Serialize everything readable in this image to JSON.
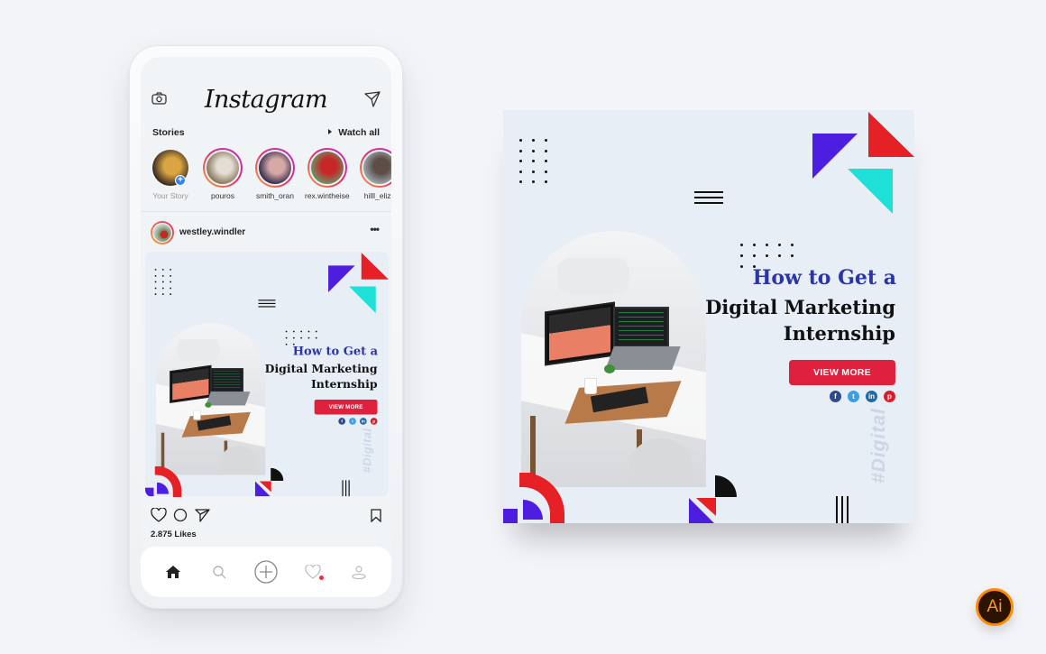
{
  "app": {
    "name": "Instagram"
  },
  "stories": {
    "label": "Stories",
    "watch_all": "Watch all",
    "items": [
      {
        "name": "Your Story",
        "own": true,
        "colors": [
          "#3a2a22",
          "#d9a441"
        ]
      },
      {
        "name": "pouros",
        "own": false,
        "colors": [
          "#8a7a5c",
          "#e4ddd3"
        ]
      },
      {
        "name": "smith_oran",
        "own": false,
        "colors": [
          "#3b3050",
          "#d6a9a6"
        ]
      },
      {
        "name": "rex.wintheiser",
        "own": false,
        "colors": [
          "#6f8f65",
          "#c62828"
        ]
      },
      {
        "name": "hilll_eliza",
        "own": false,
        "colors": [
          "#9aa3a8",
          "#5c4d45"
        ]
      }
    ]
  },
  "post": {
    "username": "westley.windler",
    "more_label": "•••",
    "likes": "2.875 Likes"
  },
  "creative": {
    "title_line1": "How to Get a",
    "title_line2": "Digital Marketing",
    "title_line3": "Internship",
    "button_label": "VIEW MORE",
    "hashtag": "#Digital",
    "socials": [
      {
        "name": "facebook",
        "glyph": "f",
        "color": "#2d4a8a"
      },
      {
        "name": "twitter",
        "glyph": "t",
        "color": "#3a9ee6"
      },
      {
        "name": "linkedin",
        "glyph": "in",
        "color": "#1c6aa8"
      },
      {
        "name": "pinterest",
        "glyph": "p",
        "color": "#d3202e"
      }
    ],
    "colors": {
      "background": "#e8eef6",
      "accent_red": "#e0213e",
      "title_blue": "#2b35a6",
      "tri_purple": "#4e1ee0",
      "tri_red": "#e52125",
      "tri_cyan": "#1ee0d6"
    }
  },
  "badge": {
    "label": "Ai"
  },
  "nav": {
    "items": [
      "home",
      "search",
      "add",
      "activity",
      "profile"
    ],
    "notification_color": "#e8323c"
  }
}
